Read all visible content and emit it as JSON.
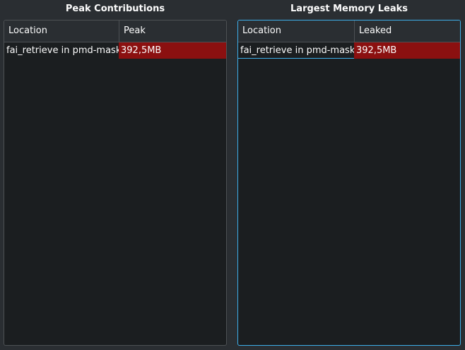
{
  "peak": {
    "title": "Peak Contributions",
    "columns": [
      "Location",
      "Peak"
    ],
    "rows": [
      {
        "location": "fai_retrieve in pmd-mask",
        "value": "392,5MB"
      }
    ]
  },
  "leaks": {
    "title": "Largest Memory Leaks",
    "columns": [
      "Location",
      "Leaked"
    ],
    "rows": [
      {
        "location": "fai_retrieve in pmd-mask",
        "value": "392,5MB"
      }
    ]
  },
  "colors": {
    "bar_fill": "#8b1010",
    "focus_accent": "#3daee9",
    "view_background": "#1b1e20"
  }
}
